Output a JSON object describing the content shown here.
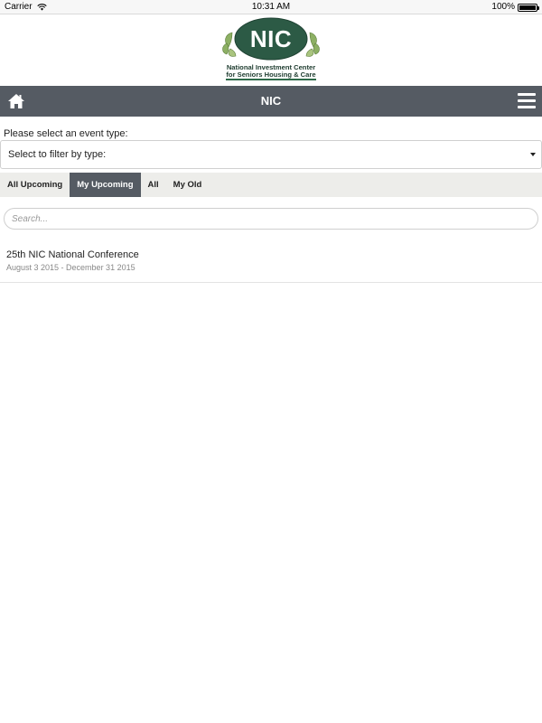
{
  "status_bar": {
    "carrier": "Carrier",
    "time": "10:31 AM",
    "battery": "100%",
    "battery_level": 1.0
  },
  "logo": {
    "initials": "NIC",
    "line1": "National Investment Center",
    "line2": "for Seniors Housing & Care",
    "colors": {
      "oval": "#2c5a45",
      "leaf": "#7fa35a"
    }
  },
  "header": {
    "title": "NIC",
    "home_icon": "home-icon",
    "menu_icon": "hamburger-menu-icon",
    "background": "#555b63"
  },
  "filter": {
    "prompt": "Please select an event type:",
    "selected": "Select to filter by type:"
  },
  "tabs": [
    {
      "label": "All Upcoming",
      "active": false
    },
    {
      "label": "My Upcoming",
      "active": true
    },
    {
      "label": "All",
      "active": false
    },
    {
      "label": "My Old",
      "active": false
    }
  ],
  "search": {
    "placeholder": "Search...",
    "value": ""
  },
  "events": [
    {
      "title": "25th NIC National Conference",
      "dates": "August 3 2015 - December 31 2015"
    }
  ]
}
